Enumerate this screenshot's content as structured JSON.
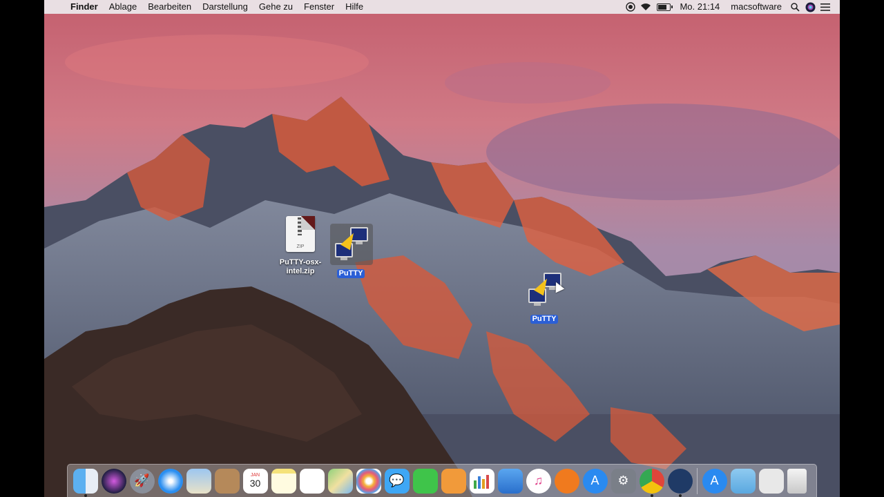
{
  "menubar": {
    "apple_icon": "apple-logo",
    "app_name": "Finder",
    "menus": [
      "Ablage",
      "Bearbeiten",
      "Darstellung",
      "Gehe zu",
      "Fenster",
      "Hilfe"
    ],
    "clock": "Mo. 21:14",
    "user": "macsoftware",
    "status_icons": [
      "screen-record-icon",
      "wifi-icon",
      "battery-icon",
      "search-icon",
      "siri-icon",
      "notification-center-icon"
    ]
  },
  "desktop": {
    "items": [
      {
        "label": "PuTTY-osx-intel.zip",
        "label_line1": "PuTTY-osx-",
        "label_line2": "intel.zip",
        "icon": "zip-archive-icon",
        "zip_text": "ZIP",
        "selected": false
      },
      {
        "label": "PuTTY",
        "icon": "putty-app-icon",
        "selected": true
      },
      {
        "label": "PuTTY",
        "icon": "putty-app-icon",
        "selected": true
      }
    ]
  },
  "dock": {
    "calendar_month": "JAN",
    "calendar_day": "30",
    "apps": [
      "Finder",
      "Siri",
      "Launchpad",
      "Safari",
      "Mail",
      "Contacts",
      "Calendar",
      "Notes",
      "Reminders",
      "Maps",
      "Photos",
      "Messages",
      "FaceTime",
      "Pages",
      "Numbers",
      "Keynote",
      "iTunes",
      "iBooks",
      "App Store",
      "System Preferences",
      "Google Chrome",
      "QuickTime Player",
      "Applications",
      "Downloads",
      "Documents",
      "Trash"
    ]
  },
  "colors": {
    "menubar": "#ece8ec",
    "selection": "#2b5fd6",
    "sky_top": "#c86a6a",
    "mountain_glow": "#e0573a"
  }
}
